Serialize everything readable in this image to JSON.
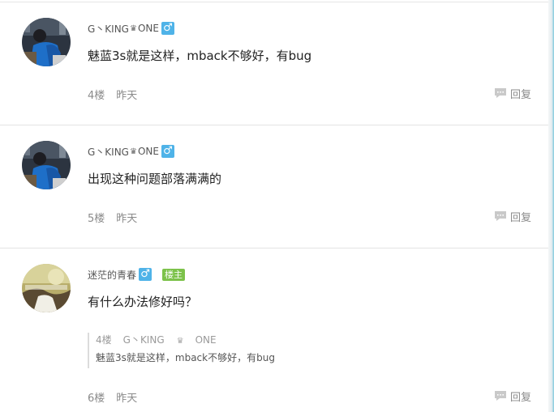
{
  "comments": [
    {
      "username": "G丶KING",
      "username_suffix": "ONE",
      "gender_symbol": "♂",
      "content": "魅蓝3s就是这样，mback不够好，有bug",
      "floor": "4楼",
      "time": "昨天",
      "reply_label": "回复"
    },
    {
      "username": "G丶KING",
      "username_suffix": "ONE",
      "gender_symbol": "♂",
      "content": "出现这种问题部落满满的",
      "floor": "5楼",
      "time": "昨天",
      "reply_label": "回复"
    },
    {
      "username": "迷茫的青春",
      "gender_symbol": "♂",
      "badge": "楼主",
      "content": "有什么办法修好吗？",
      "quote": {
        "floor": "4楼",
        "username": "G丶KING",
        "username_suffix": "ONE",
        "text": "魅蓝3s就是这样，mback不够好，有bug"
      },
      "floor": "6楼",
      "time": "昨天",
      "reply_label": "回复"
    }
  ],
  "icons": {
    "crown": "crown-icon",
    "gender": "male-icon",
    "reply": "speech-bubble-icon"
  },
  "colors": {
    "gender_badge": "#4fb3e8",
    "host_badge": "#7cc24a",
    "divider": "#e3e3e3",
    "meta_text": "#8a8a8a"
  }
}
